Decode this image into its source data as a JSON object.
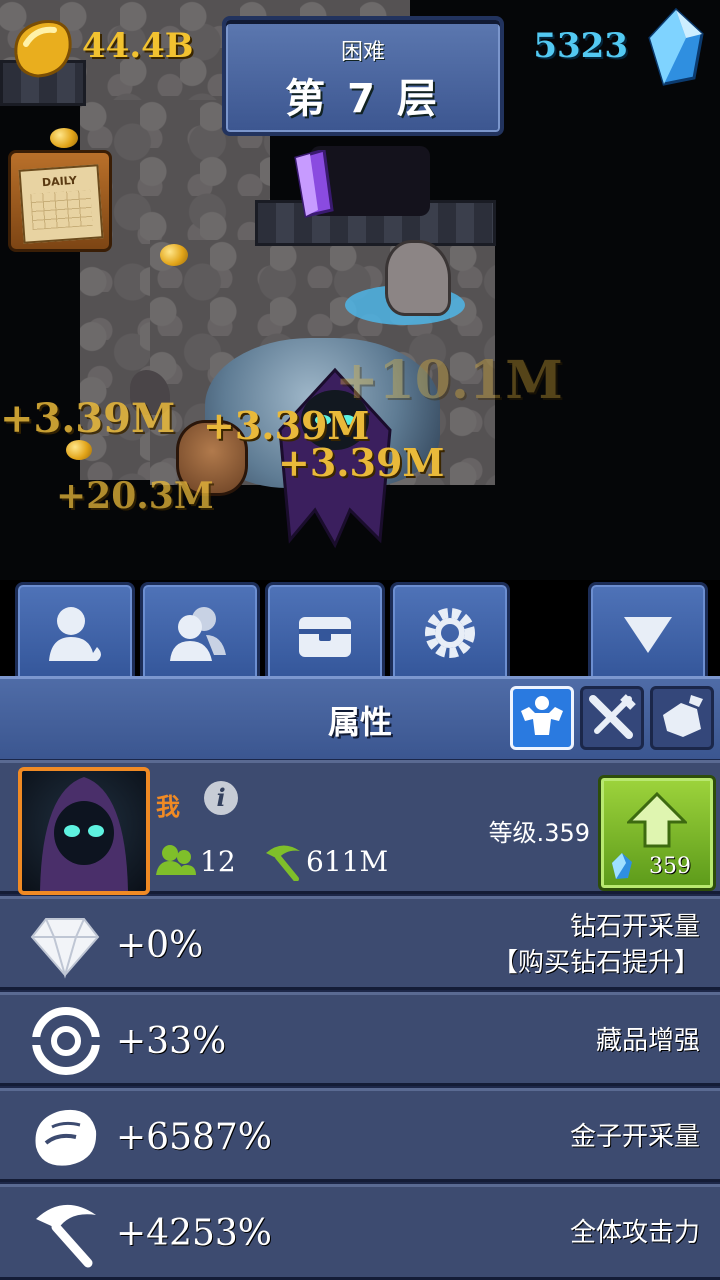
{
  "hud": {
    "gold": "44.4B",
    "gems": "5323"
  },
  "level": {
    "difficulty": "困难",
    "floor": "第 7 层"
  },
  "floating_numbers": [
    "+3.39M",
    "+3.39M",
    "+3.39M",
    "+20.3M",
    "+10.1M"
  ],
  "daily_label": "DAILY",
  "tabs": [
    {
      "icon": "hero-icon"
    },
    {
      "icon": "team-icon"
    },
    {
      "icon": "chest-icon"
    },
    {
      "icon": "gear-icon"
    },
    {
      "icon": "collapse-arrow-icon"
    }
  ],
  "panel": {
    "title": "属性",
    "subtabs": [
      {
        "icon": "strength-icon",
        "active": true
      },
      {
        "icon": "crossed-weapons-icon",
        "active": false
      },
      {
        "icon": "ore-icon",
        "active": false
      }
    ]
  },
  "player": {
    "name": "我",
    "followers": "12",
    "attack": "611M",
    "level_text": "等级.359",
    "upgrade_cost": "359"
  },
  "stats": [
    {
      "icon": "diamond-icon",
      "value": "+0%",
      "label_line1": "钻石开采量",
      "label_line2": "【购买钻石提升】"
    },
    {
      "icon": "collectible-icon",
      "value": "+33%",
      "label_line1": "藏品增强",
      "label_line2": ""
    },
    {
      "icon": "gold-rock-icon",
      "value": "+6587%",
      "label_line1": "金子开采量",
      "label_line2": ""
    },
    {
      "icon": "pickaxe-icon",
      "value": "+4253%",
      "label_line1": "全体攻击力",
      "label_line2": ""
    }
  ],
  "colors": {
    "gold_text": "#f2c230",
    "gem_text": "#53c9f2",
    "panel_bg": "#3d4b70",
    "accent_green": "#7fbf2a",
    "orange_name": "#f08a24"
  }
}
